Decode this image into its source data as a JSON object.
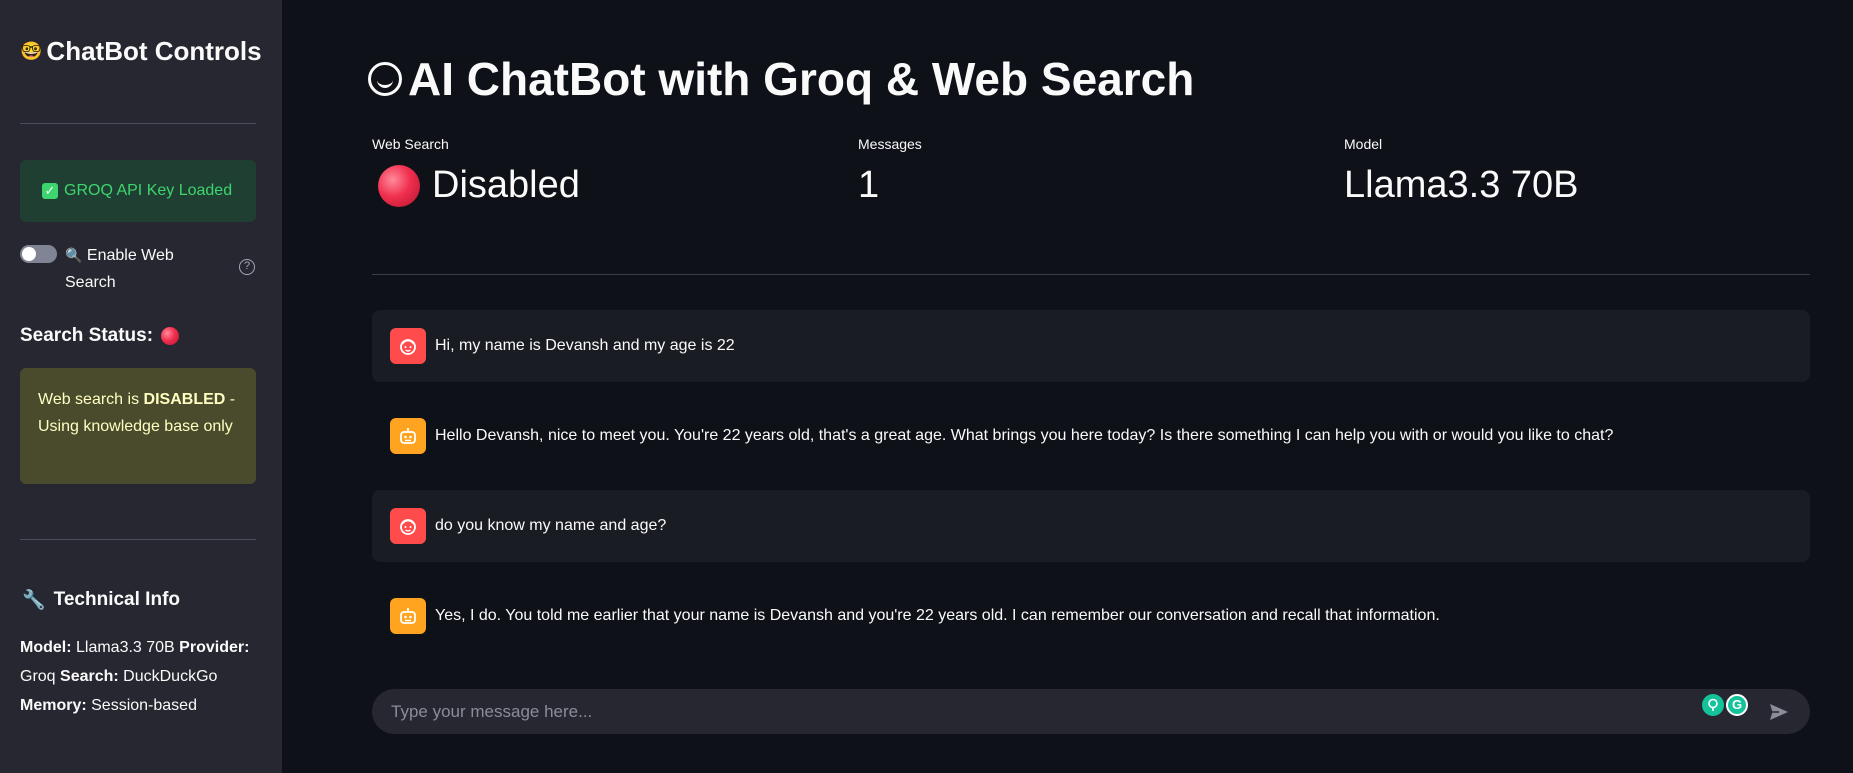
{
  "sidebar": {
    "title_emoji": "🤓",
    "title": "ChatBot Controls",
    "api_status": "GROQ API Key Loaded",
    "toggle_label": "Enable Web Search",
    "toggle_emoji": "🔍",
    "search_status_label": "Search Status:",
    "warning": {
      "prefix": "Web search is ",
      "emphasis": "DISABLED",
      "suffix": " - Using knowledge base only"
    },
    "tech_title_emoji": "🔧",
    "tech_title": "Technical Info",
    "tech": {
      "model_label": "Model:",
      "model_value": " Llama3.3 70B ",
      "provider_label": "Provider:",
      "provider_value": " Groq ",
      "search_label": "Search:",
      "search_value": " DuckDuckGo",
      "memory_label": "Memory:",
      "memory_value": " Session-based"
    }
  },
  "main": {
    "title": "AI ChatBot with Groq & Web Search",
    "metrics": {
      "web_search_label": "Web Search",
      "web_search_value": "Disabled",
      "messages_label": "Messages",
      "messages_value": "1",
      "model_label": "Model",
      "model_value": "Llama3.3 70B"
    },
    "messages": [
      {
        "role": "user",
        "text": "Hi, my name is Devansh and my age is 22"
      },
      {
        "role": "assistant",
        "text": "Hello Devansh, nice to meet you. You're 22 years old, that's a great age. What brings you here today? Is there something I can help you with or would you like to chat?"
      },
      {
        "role": "user",
        "text": "do you know my name and age?"
      },
      {
        "role": "assistant",
        "text": "Yes, I do. You told me earlier that your name is Devansh and you're 22 years old. I can remember our conversation and recall that information."
      }
    ],
    "input_placeholder": "Type your message here..."
  },
  "colors": {
    "background": "#0e1117",
    "sidebar": "#262730",
    "success_bg": "#1f3f33",
    "success_text": "#3dd56d",
    "warning_bg": "#4a4a2c",
    "user_avatar": "#ff4b4b",
    "bot_avatar": "#ffa421"
  },
  "icons": [
    "nerd-face-icon",
    "check-icon",
    "magnifier-icon",
    "help-icon",
    "red-circle-icon",
    "wrench-icon",
    "user-face-icon",
    "robot-icon",
    "grammarly-icon",
    "send-icon"
  ]
}
